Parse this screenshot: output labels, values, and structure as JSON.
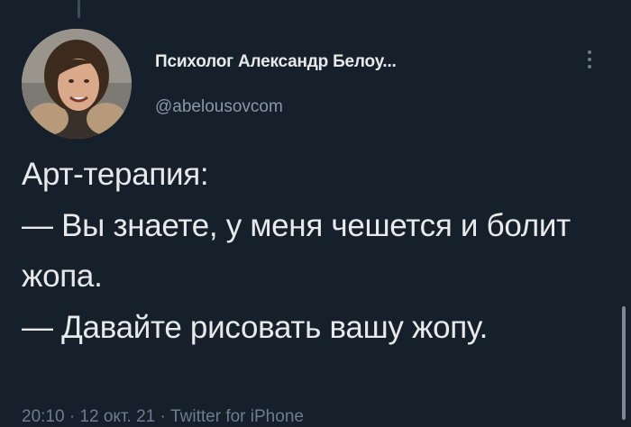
{
  "author": {
    "name": "Психолог Александр Белоу...",
    "handle": "@abelousovcom"
  },
  "tweet": {
    "text": "Арт-терапия:\n— Вы знаете, у меня чешется и болит жопа.\n— Давайте рисовать вашу жопу."
  },
  "meta": {
    "timestamp_source": "20:10 · 12 окт. 21 · Twitter for iPhone"
  },
  "icons": {
    "more": "more-vertical-icon",
    "avatar": "avatar"
  },
  "colors": {
    "background": "#15202b",
    "text": "#e7e9ea",
    "secondary": "#8b98a5"
  }
}
